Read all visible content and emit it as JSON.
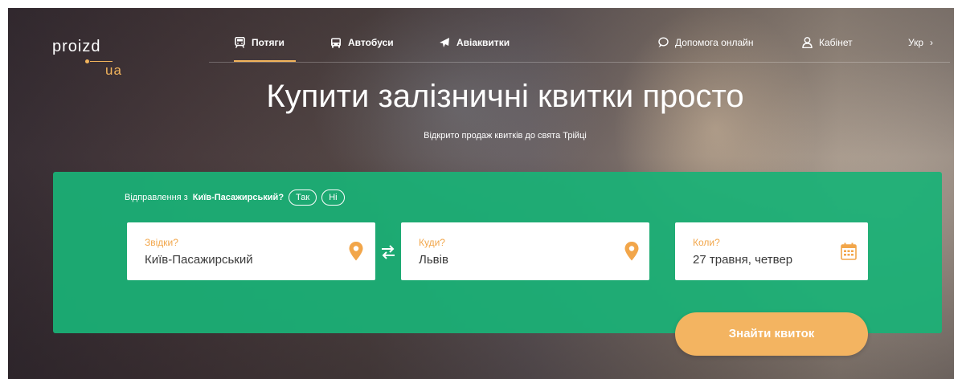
{
  "logo": {
    "line1": "proizd",
    "line2": "ua"
  },
  "nav": {
    "trains": "Потяги",
    "buses": "Автобуси",
    "avia": "Авіаквитки",
    "help": "Допомога онлайн",
    "cabinet": "Кабінет",
    "lang": "Укр",
    "lang_arrow": "›"
  },
  "hero": {
    "title": "Купити залізничні квитки просто",
    "subtitle": "Відкрито продаж квитків до свята Трійці"
  },
  "departure": {
    "prefix": "Відправлення з",
    "city": "Київ-Пасажирський?",
    "yes": "Так",
    "no": "Ні"
  },
  "search": {
    "from_label": "Звідки?",
    "from_value": "Київ-Пасажирський",
    "to_label": "Куди?",
    "to_value": "Львів",
    "date_label": "Коли?",
    "date_value": "27 травня, четвер",
    "button": "Знайти квиток"
  },
  "colors": {
    "accent": "#f2b45c",
    "panel": "#1ab276",
    "button": "#f3b461"
  },
  "icons": [
    "train-icon",
    "bus-icon",
    "plane-icon",
    "chat-icon",
    "user-icon",
    "location-pin-icon",
    "swap-icon",
    "calendar-icon"
  ]
}
